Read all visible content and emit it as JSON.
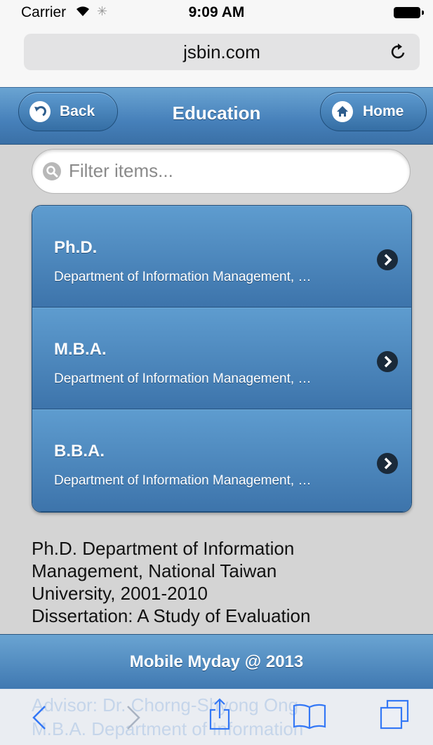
{
  "status_bar": {
    "carrier": "Carrier",
    "time": "9:09 AM"
  },
  "address_bar": {
    "url": "jsbin.com"
  },
  "header": {
    "back_label": "Back",
    "title": "Education",
    "home_label": "Home"
  },
  "filter": {
    "placeholder": "Filter items..."
  },
  "list": {
    "items": [
      {
        "title": "Ph.D.",
        "subtitle": "Department of Information Management, …"
      },
      {
        "title": "M.B.A.",
        "subtitle": "Department of Information Management, …"
      },
      {
        "title": "B.B.A.",
        "subtitle": "Department of Information Management, …"
      }
    ]
  },
  "detail": {
    "lines": [
      "Ph.D. Department of Information",
      "Management, National Taiwan",
      "University, 2001-2010",
      "Dissertation: A Study of Evaluation"
    ]
  },
  "footer": {
    "text": "Mobile Myday @ 2013"
  },
  "hidden_behind_toolbar": {
    "line1": "Advisor: Dr. Chorng-Shyong Ong",
    "line2": "M.B.A. Department of Information"
  },
  "colors": {
    "header_blue": "#4680ba",
    "toolbar_tint": "#3478f6"
  },
  "icons": {
    "status": [
      "wifi-icon",
      "spinner-icon",
      "battery-icon"
    ],
    "toolbar": [
      "back-arrow-icon",
      "forward-arrow-icon",
      "share-icon",
      "bookmarks-icon",
      "tabs-icon"
    ]
  }
}
